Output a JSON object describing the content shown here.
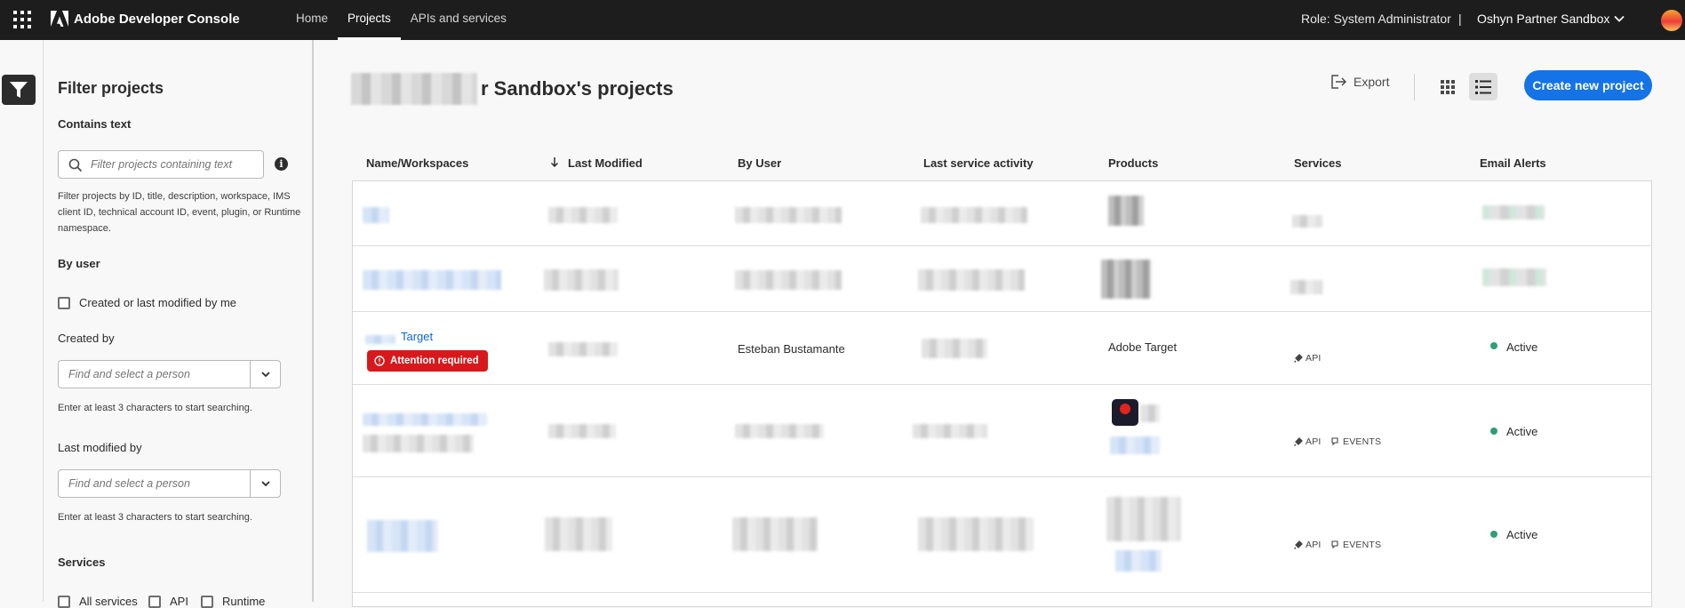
{
  "header": {
    "brand": "Adobe Developer Console",
    "nav": [
      {
        "label": "Home",
        "active": false
      },
      {
        "label": "Projects",
        "active": true
      },
      {
        "label": "APIs and services",
        "active": false
      }
    ],
    "role": "Role: System Administrator",
    "separator": "|",
    "org": "Oshyn Partner Sandbox"
  },
  "sidebar": {
    "title": "Filter projects",
    "contains_text": {
      "heading": "Contains text",
      "placeholder": "Filter projects containing text",
      "help": "Filter projects by ID, title, description, workspace, IMS client ID, technical account ID, event, plugin, or Runtime namespace."
    },
    "by_user": {
      "heading": "By user",
      "checkbox_label": "Created or last modified by me",
      "created_by_label": "Created by",
      "created_by_placeholder": "Find and select a person",
      "created_by_help": "Enter at least 3 characters to start searching.",
      "last_modified_label": "Last modified by",
      "last_modified_placeholder": "Find and select a person",
      "last_modified_help": "Enter at least 3 characters to start searching."
    },
    "services": {
      "heading": "Services",
      "options": [
        "All services",
        "API",
        "Runtime"
      ]
    }
  },
  "main": {
    "title_suffix": "r Sandbox's projects",
    "export_label": "Export",
    "create_label": "Create new project",
    "columns": [
      "Name/Workspaces",
      "Last Modified",
      "By User",
      "Last service activity",
      "Products",
      "Services",
      "Email Alerts"
    ],
    "sort_indicator": "↓",
    "rows": [
      {
        "name": "Target",
        "badge": "Attention required",
        "by_user": "Esteban Bustamante",
        "product": "Adobe Target",
        "services": [
          "API"
        ],
        "alert": "Active"
      },
      {
        "services": [
          "API",
          "EVENTS"
        ],
        "alert": "Active"
      },
      {
        "services": [
          "API",
          "EVENTS"
        ],
        "alert": "Active"
      }
    ]
  },
  "colors": {
    "topbar": "#1d1d1d",
    "accent": "#1473e6",
    "link": "#0d66d0",
    "attention": "#d7191b",
    "active_dot": "#2d9d78"
  },
  "icons": [
    "apps-icon",
    "adobe-logo-icon",
    "chevron-down-icon",
    "filter-icon",
    "search-icon",
    "info-icon",
    "export-icon",
    "grid-view-icon",
    "list-view-icon",
    "sort-arrow-icon",
    "alert-icon",
    "api-plug-icon",
    "events-icon"
  ]
}
